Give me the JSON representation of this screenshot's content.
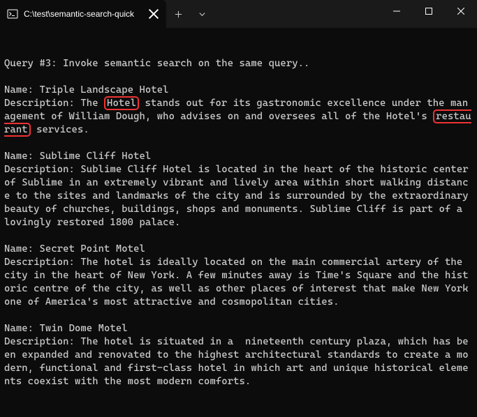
{
  "window": {
    "tab_title": "C:\\test\\semantic-search-quick"
  },
  "terminal": {
    "query_header": "Query #3: Invoke semantic search on the same query..",
    "results": [
      {
        "name_label": "Name:",
        "name": "Triple Landscape Hotel",
        "desc_label": "Description:",
        "desc_pre1": "The ",
        "hl1": "Hotel",
        "desc_mid": " stands out for its gastronomic excellence under the management of William Dough, who advises on and oversees all of the Hotel's ",
        "hl2": "restaurant",
        "desc_post": " services."
      },
      {
        "name_label": "Name:",
        "name": "Sublime Cliff Hotel",
        "desc_label": "Description:",
        "desc": "Sublime Cliff Hotel is located in the heart of the historic center of Sublime in an extremely vibrant and lively area within short walking distance to the sites and landmarks of the city and is surrounded by the extraordinary beauty of churches, buildings, shops and monuments. Sublime Cliff is part of a lovingly restored 1800 palace."
      },
      {
        "name_label": "Name:",
        "name": "Secret Point Motel",
        "desc_label": "Description:",
        "desc": "The hotel is ideally located on the main commercial artery of the city in the heart of New York. A few minutes away is Time's Square and the historic centre of the city, as well as other places of interest that make New York one of America's most attractive and cosmopolitan cities."
      },
      {
        "name_label": "Name:",
        "name": "Twin Dome Motel",
        "desc_label": "Description:",
        "desc": "The hotel is situated in a  nineteenth century plaza, which has been expanded and renovated to the highest architectural standards to create a modern, functional and first-class hotel in which art and unique historical elements coexist with the most modern comforts."
      }
    ]
  }
}
